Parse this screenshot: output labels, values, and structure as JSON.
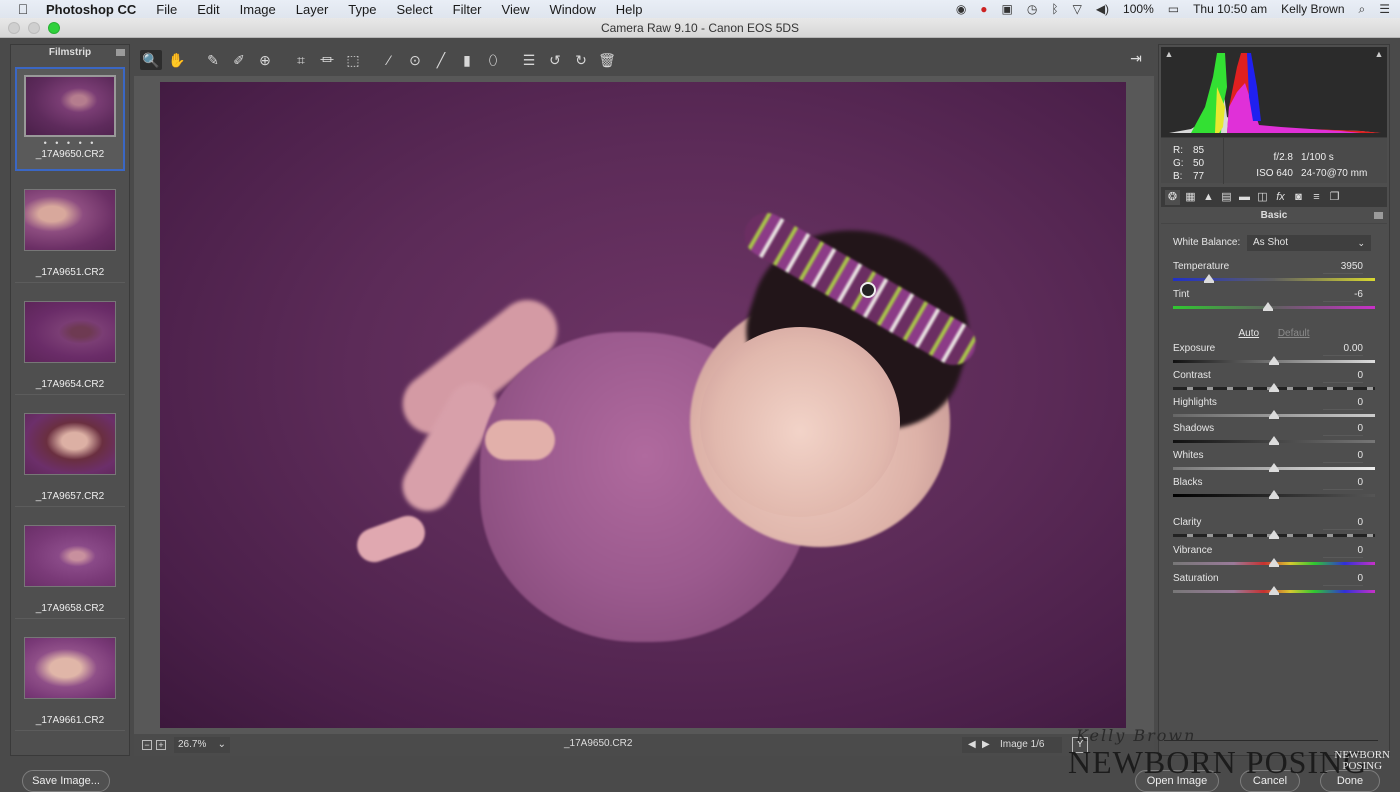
{
  "menubar": {
    "app_name": "Photoshop CC",
    "items": [
      "File",
      "Edit",
      "Image",
      "Layer",
      "Type",
      "Select",
      "Filter",
      "View",
      "Window",
      "Help"
    ],
    "status": {
      "battery": "100%",
      "clock": "Thu 10:50 am",
      "user": "Kelly Brown"
    },
    "status_icons": [
      "record-icon",
      "creative-cloud-icon",
      "app-icon",
      "time-machine-icon",
      "bluetooth-icon",
      "wifi-icon",
      "volume-icon",
      "battery-icon",
      "spotlight-icon",
      "notification-center-icon"
    ]
  },
  "window": {
    "title": "Camera Raw 9.10  -  Canon EOS 5DS"
  },
  "filmstrip": {
    "title": "Filmstrip",
    "items": [
      {
        "label": "_17A9650.CR2",
        "selected": true,
        "rating_dots": "• • • • •"
      },
      {
        "label": "_17A9651.CR2",
        "selected": false
      },
      {
        "label": "_17A9654.CR2",
        "selected": false
      },
      {
        "label": "_17A9657.CR2",
        "selected": false
      },
      {
        "label": "_17A9658.CR2",
        "selected": false
      },
      {
        "label": "_17A9661.CR2",
        "selected": false
      }
    ]
  },
  "toolbar": {
    "tools": [
      {
        "name": "zoom-tool",
        "glyph": "🔍",
        "active": true
      },
      {
        "name": "hand-tool",
        "glyph": "✋"
      },
      {
        "name": "white-balance-tool",
        "glyph": "✎"
      },
      {
        "name": "color-sampler-tool",
        "glyph": "✐"
      },
      {
        "name": "targeted-adjustment-tool",
        "glyph": "⊕"
      },
      {
        "name": "crop-tool",
        "glyph": "⌗"
      },
      {
        "name": "straighten-tool",
        "glyph": "⏛"
      },
      {
        "name": "transform-tool",
        "glyph": "⬚"
      },
      {
        "name": "spot-removal-tool",
        "glyph": "⁄"
      },
      {
        "name": "red-eye-tool",
        "glyph": "⊙"
      },
      {
        "name": "adjustment-brush-tool",
        "glyph": "╱"
      },
      {
        "name": "graduated-filter-tool",
        "glyph": "▮"
      },
      {
        "name": "radial-filter-tool",
        "glyph": "⬯"
      },
      {
        "name": "preferences-tool",
        "glyph": "☰"
      },
      {
        "name": "rotate-left-tool",
        "glyph": "↺"
      },
      {
        "name": "rotate-right-tool",
        "glyph": "↻"
      },
      {
        "name": "trash-tool",
        "glyph": "🗑"
      }
    ],
    "fullscreen_glyph": "⇥"
  },
  "statusbar": {
    "zoom_level": "26.7%",
    "filename": "_17A9650.CR2",
    "image_counter": "Image 1/6",
    "y_label": "Y"
  },
  "histogram": {
    "rgb": {
      "r": "85",
      "g": "50",
      "b": "77"
    },
    "labels": {
      "r": "R:",
      "g": "G:",
      "b": "B:"
    },
    "aperture": "f/2.8",
    "shutter": "1/100 s",
    "iso": "ISO 640",
    "lens": "24-70@70 mm"
  },
  "panel": {
    "tabs": [
      "basic",
      "tone-curve",
      "detail",
      "hsl",
      "split-toning",
      "lens-corrections",
      "effects",
      "camera-calibration",
      "presets",
      "snapshots"
    ],
    "tab_glyphs": [
      "❂",
      "▦",
      "▲",
      "▤",
      "▬",
      "◫",
      "fx",
      "◙",
      "≡",
      "❐"
    ],
    "title": "Basic",
    "white_balance_label": "White Balance:",
    "white_balance_value": "As Shot",
    "auto_label": "Auto",
    "default_label": "Default",
    "sliders": [
      {
        "id": "temperature",
        "label": "Temperature",
        "value": "3950",
        "position": 0.18
      },
      {
        "id": "tint",
        "label": "Tint",
        "value": "-6",
        "position": 0.47
      },
      {
        "id": "exposure",
        "label": "Exposure",
        "value": "0.00",
        "position": 0.5
      },
      {
        "id": "contrast",
        "label": "Contrast",
        "value": "0",
        "position": 0.5
      },
      {
        "id": "highlights",
        "label": "Highlights",
        "value": "0",
        "position": 0.5
      },
      {
        "id": "shadows",
        "label": "Shadows",
        "value": "0",
        "position": 0.5
      },
      {
        "id": "whites",
        "label": "Whites",
        "value": "0",
        "position": 0.5
      },
      {
        "id": "blacks",
        "label": "Blacks",
        "value": "0",
        "position": 0.5
      },
      {
        "id": "clarity",
        "label": "Clarity",
        "value": "0",
        "position": 0.5
      },
      {
        "id": "vibrance",
        "label": "Vibrance",
        "value": "0",
        "position": 0.5
      },
      {
        "id": "saturation",
        "label": "Saturation",
        "value": "0",
        "position": 0.5
      }
    ]
  },
  "buttons": {
    "save_image": "Save Image...",
    "open_image": "Open Image",
    "cancel": "Cancel",
    "done": "Done"
  },
  "watermark": {
    "script": "Kelly Brown",
    "big": "NEWBORN POSING",
    "small_line1": "NEWBORN",
    "small_line2": "POSING"
  },
  "colors": {
    "backdrop_purple": "#5c2b58",
    "selection_blue": "#3b67c4",
    "panel_gray": "#4e4e4e"
  }
}
